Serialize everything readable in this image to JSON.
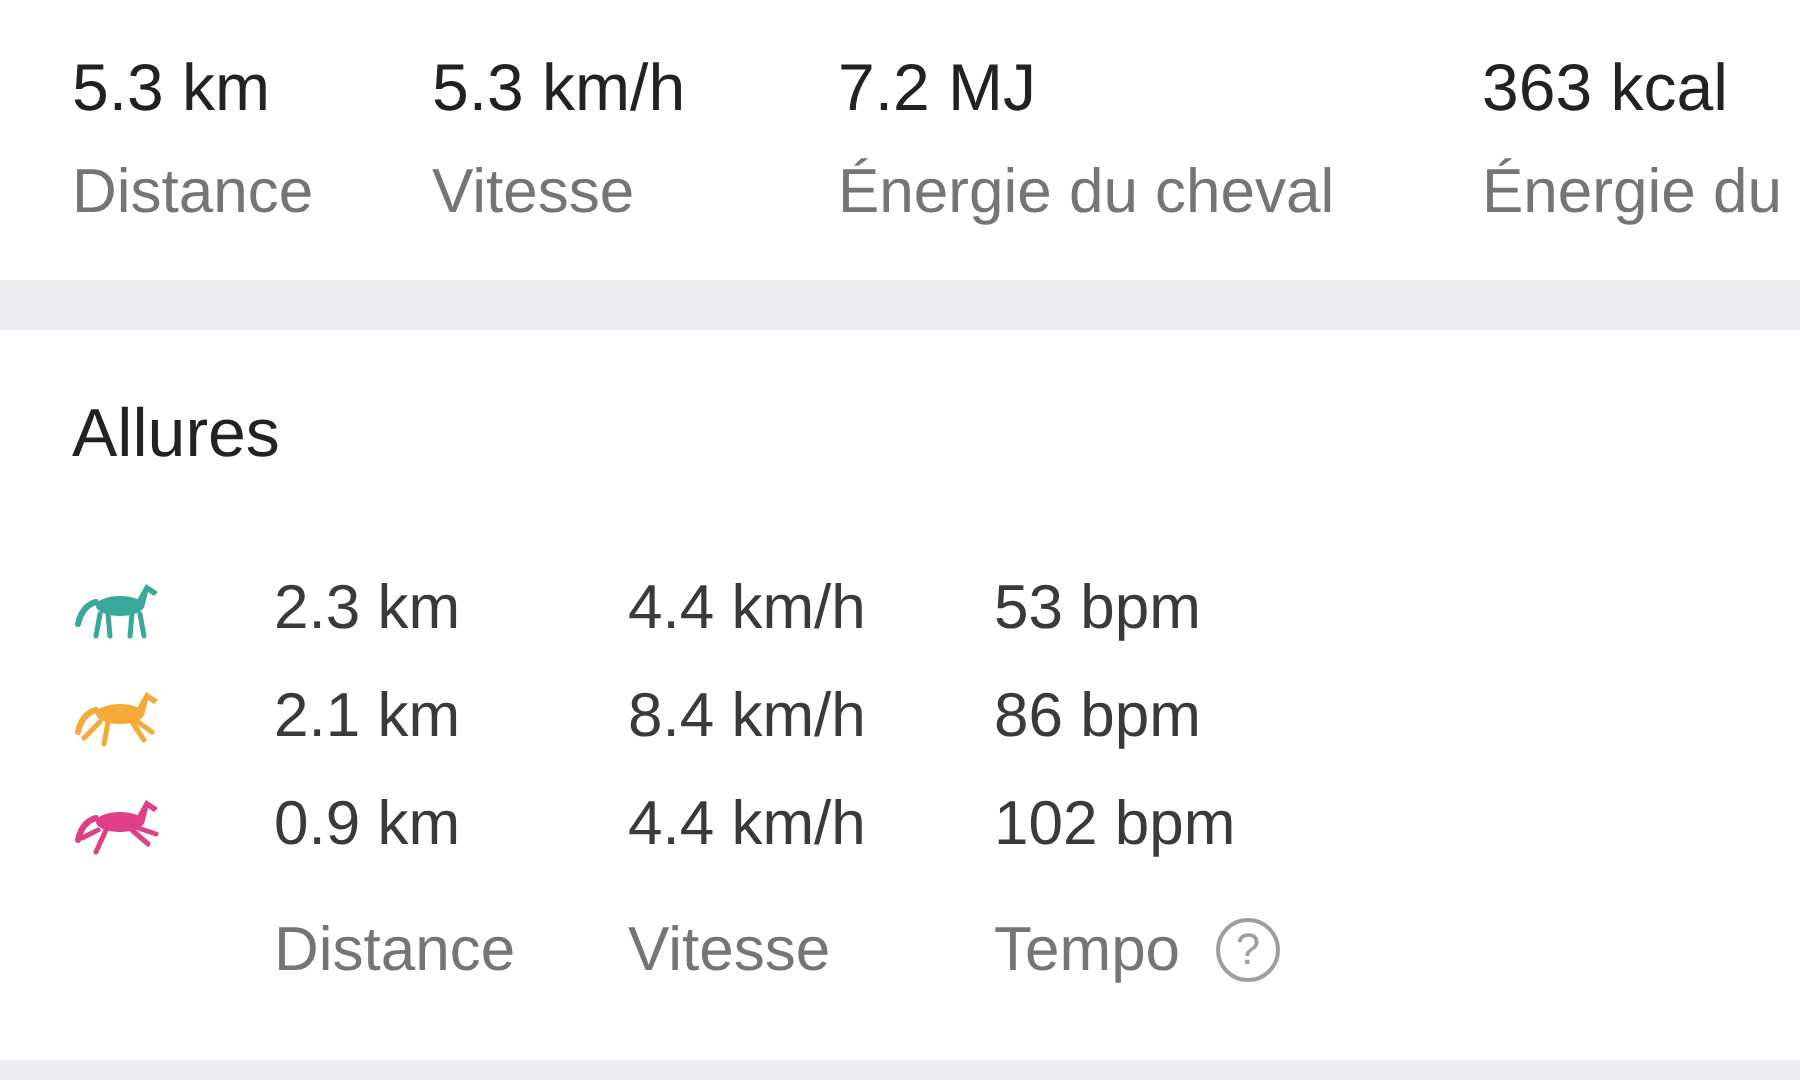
{
  "summary": [
    {
      "value": "5.3 km",
      "label": "Distance"
    },
    {
      "value": "5.3 km/h",
      "label": "Vitesse"
    },
    {
      "value": "7.2 MJ",
      "label": "Énergie du cheval"
    },
    {
      "value": "363 kcal",
      "label": "Énergie du"
    }
  ],
  "gaits_card": {
    "title": "Allures",
    "rows": [
      {
        "kind": "walk",
        "color": "#3aa89b",
        "distance": "2.3 km",
        "speed": "4.4 km/h",
        "tempo": "53 bpm"
      },
      {
        "kind": "canter",
        "color": "#f7a937",
        "distance": "2.1 km",
        "speed": "8.4 km/h",
        "tempo": "86 bpm"
      },
      {
        "kind": "gallop",
        "color": "#de3f86",
        "distance": "0.9 km",
        "speed": "4.4 km/h",
        "tempo": "102 bpm"
      }
    ],
    "footer": {
      "distance": "Distance",
      "speed": "Vitesse",
      "tempo": "Tempo",
      "help": "?"
    }
  }
}
